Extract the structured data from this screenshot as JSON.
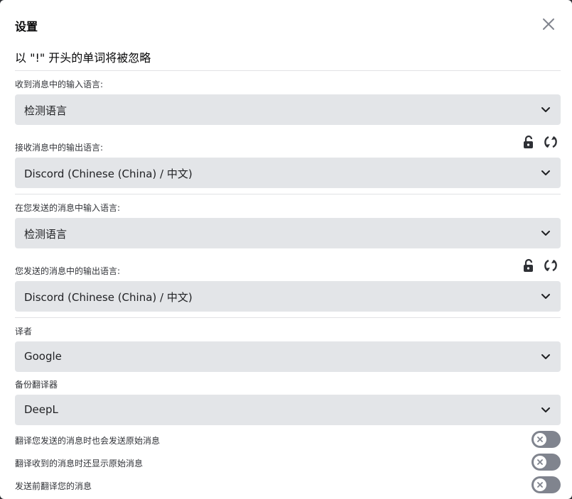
{
  "dialog": {
    "title": "设置",
    "notice": "以 \"!\" 开头的单词将被忽略"
  },
  "fields": {
    "received_input": {
      "label": "收到消息中的输入语言:",
      "value": "检测语言"
    },
    "received_output": {
      "label": "接收消息中的输出语言:",
      "value": "Discord (Chinese (China) / 中文)"
    },
    "sent_input": {
      "label": "在您发送的消息中输入语言:",
      "value": "检测语言"
    },
    "sent_output": {
      "label": "您发送的消息中的输出语言:",
      "value": "Discord (Chinese (China) / 中文)"
    },
    "translator": {
      "label": "译者",
      "value": "Google"
    },
    "backup_translator": {
      "label": "备份翻译器",
      "value": "DeepL"
    }
  },
  "toggles": [
    {
      "label": "翻译您发送的消息时也会发送原始消息",
      "enabled": false
    },
    {
      "label": "翻译收到的消息时还显示原始消息",
      "enabled": false
    },
    {
      "label": "发送前翻译您的消息",
      "enabled": false
    }
  ],
  "icons": {
    "close": "close-icon",
    "chevron": "chevron-down-icon",
    "lock": "lock-icon",
    "swap": "swap-icon",
    "toggle_off": "x-icon"
  },
  "colors": {
    "select_bg": "#e3e5e8",
    "toggle_off": "#80848e",
    "divider": "#e1e2e5"
  }
}
